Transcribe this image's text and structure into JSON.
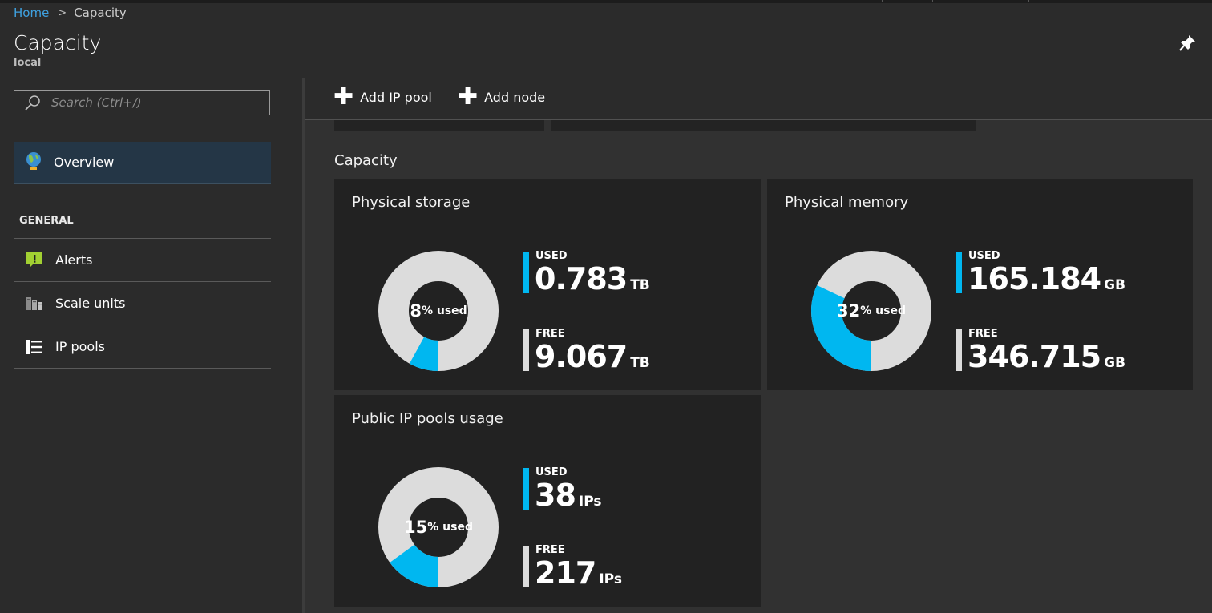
{
  "breadcrumb": {
    "home": "Home",
    "separator": ">",
    "current": "Capacity"
  },
  "header": {
    "title": "Capacity",
    "subtitle": "local",
    "pin_icon": "pin-icon"
  },
  "sidebar": {
    "search_placeholder": "Search (Ctrl+/)",
    "overview_label": "Overview",
    "section_label": "GENERAL",
    "items": [
      {
        "label": "Alerts",
        "icon": "alert-icon"
      },
      {
        "label": "Scale units",
        "icon": "scale-units-icon"
      },
      {
        "label": "IP pools",
        "icon": "ip-pools-icon"
      }
    ]
  },
  "toolbar": {
    "add_ip_pool": "Add IP pool",
    "add_node": "Add node",
    "plus": "✚"
  },
  "capacity_section": "Capacity",
  "used_caption": "USED",
  "free_caption": "FREE",
  "percent_suffix": "% used",
  "cards": [
    {
      "title": "Physical storage",
      "percent": "8",
      "used_value": "0.783",
      "used_unit": "TB",
      "free_value": "9.067",
      "free_unit": "TB"
    },
    {
      "title": "Physical memory",
      "percent": "32",
      "used_value": "165.184",
      "used_unit": "GB",
      "free_value": "346.715",
      "free_unit": "GB"
    },
    {
      "title": "Public IP pools usage",
      "percent": "15",
      "used_value": "38",
      "used_unit": "IPs",
      "free_value": "217",
      "free_unit": "IPs"
    }
  ],
  "colors": {
    "used": "#00b7f0",
    "free": "#dcdcdc",
    "accent": "#3fa1e0",
    "card_bg": "#222222"
  }
}
